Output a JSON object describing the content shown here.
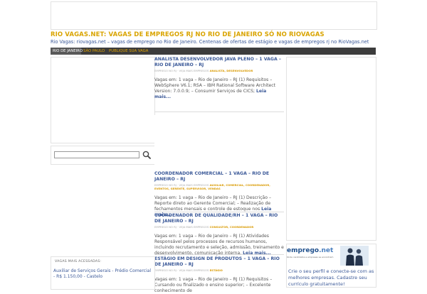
{
  "site": {
    "title": "RIO VAGAS.NET: VAGAS DE EMPREGOS RJ NO RIO DE JANEIRO SÓ NO RIOVAGAS",
    "description": "Rio Vagas: riovagas.net – vagas de emprego no Rio de Janeiro. Centenas de ofertas de estágio e vagas de empregos rj no RioVagas.net"
  },
  "nav": {
    "items": [
      "Rio de Janeiro",
      "São Paulo",
      "Publique sua vaga"
    ]
  },
  "search": {
    "placeholder": ""
  },
  "posts": [
    {
      "title": "ANALISTA DESENVOLVEDOR JAVA PLENO – 1 VAGA – RIO DE JANEIRO – RJ",
      "meta": "EMPREGO NO RJ · VEJA MAIS EMPREGOS",
      "tags": "ANALISTA, DESENVOLVEDOR",
      "body": "Vagas em: 1 vaga – Rio de Janeiro – RJ (1) Requisitos – WebSphere V6.1; RSA – IBM Rational Software Architect Version: 7.0.0.9; – Consumir Serviços de CICS;",
      "more": "Leia mais..."
    },
    {
      "title": "COORDENADOR COMERCIAL – 1 VAGA – RIO DE JANEIRO – RJ",
      "meta": "EMPREGO NO RJ · VEJA MAIS EMPREGOS",
      "tags": "AUXILIAR, COMERCIAL, COORDENADOR, EVENTOS, GERENTE, SUPERVISOR, VENDAS",
      "body": "Vagas em: 1 vaga – Rio de Janeiro – RJ (1) Descrição – Reporte direto ao Gerente Comercial; – Realização de fechamentos mensais e controle de estoque nos",
      "more": "Leia mais..."
    },
    {
      "title": "COORDENADOR DE QUALIDADE/RH – 1 VAGA – RIO DE JANEIRO – RJ",
      "meta": "EMPREGO NO RJ · VEJA MAIS EMPREGOS",
      "tags": "CONSULTOR, COORDENADOR",
      "body": "Vagas em: 1 vaga – Rio de Janeiro – RJ (1) Atividades Responsável pelos processos de recursos humanos, incluindo recrutamento e seleção, admissão, treinamento e desenvolvimento, comunicação interna.",
      "more": "Leia mais..."
    },
    {
      "title": "ESTÁGIO EM DESIGN DE PRODUTOS – 1 VAGA – RIO DE JANEIRO – RJ",
      "meta": "EMPREGO NO RJ · VEJA MAIS EMPREGOS",
      "tags": "ESTÁGIO",
      "body": "Vagas em: 1 vaga – Rio de Janeiro – RJ (1) Requisitos – Cursando ou finalizado o ensino superior; – Excelente conhecimento de",
      "more": ""
    }
  ],
  "sidebar_list": {
    "title": "VAGAS MAIS ACESSADAS:",
    "items": [
      "Auxiliar de Serviços Gerais - Prédio Comercial - R$ 1.150,00 - Castelo"
    ]
  },
  "promo": {
    "logo_main": "emprego",
    "logo_dot": ".net",
    "tagline": "Onde candidatos e empresas se encontram",
    "text": "Crie o seu perfil e conecte-se com as melhores empresas. Cadastre seu currículo gratuitamente!"
  }
}
